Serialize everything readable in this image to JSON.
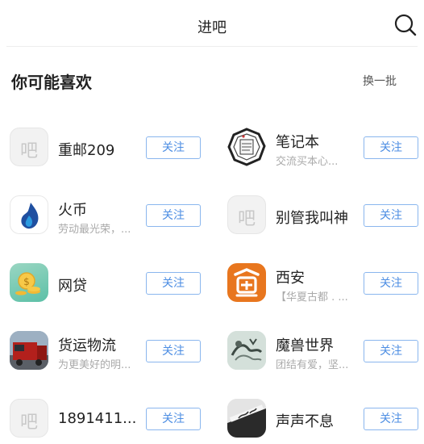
{
  "header": {
    "title": "进吧",
    "search_icon": "search-icon"
  },
  "section": {
    "heading": "你可能喜欢",
    "refresh_label": "换一批"
  },
  "follow_label": "关注",
  "items": [
    {
      "name": "重邮209",
      "desc": "",
      "avatar": "placeholder",
      "placeholder_char": "吧"
    },
    {
      "name": "笔记本",
      "desc": "交流买本心...",
      "avatar": "notebook-stamp"
    },
    {
      "name": "火币",
      "desc": "劳动最光荣，...",
      "avatar": "huobi-flame"
    },
    {
      "name": "别管我叫神",
      "desc": "",
      "avatar": "placeholder",
      "placeholder_char": "吧"
    },
    {
      "name": "网贷",
      "desc": "",
      "avatar": "coin-green"
    },
    {
      "name": "西安",
      "desc": "【华夏古都 . ...",
      "avatar": "xian-orange"
    },
    {
      "name": "货运物流",
      "desc": "为更美好的明...",
      "avatar": "red-truck"
    },
    {
      "name": "魔兽世界",
      "desc": "团结有爱，坚...",
      "avatar": "wow-ink"
    },
    {
      "name": "1891411...",
      "desc": "",
      "avatar": "placeholder",
      "placeholder_char": "吧"
    },
    {
      "name": "声声不息",
      "desc": "",
      "avatar": "calligraphy"
    }
  ]
}
